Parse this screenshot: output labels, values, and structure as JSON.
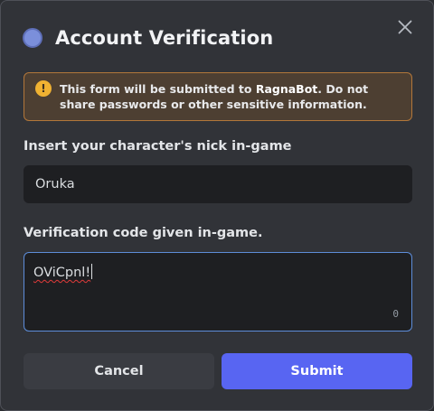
{
  "modal": {
    "title": "Account Verification",
    "close_icon": "close-icon",
    "avatar_color": "#7b8fdb"
  },
  "notice": {
    "icon": "warning-icon",
    "icon_glyph": "!",
    "text_before": "This form will be submitted to ",
    "bot_name": "RagnaBot",
    "text_after": ". Do not share passwords or other sensitive information.",
    "border_color": "#b2773a",
    "background_color": "#4d3f32"
  },
  "fields": {
    "nick": {
      "label": "Insert your character's nick in-game",
      "value": "Oruka"
    },
    "code": {
      "label": "Verification code given in-game.",
      "value": "OViCpnl!",
      "counter": "0"
    }
  },
  "buttons": {
    "cancel": "Cancel",
    "submit": "Submit"
  },
  "colors": {
    "submit_accent": "#5865f2",
    "focus_border": "#5d8dd9",
    "modal_background": "#313338"
  }
}
